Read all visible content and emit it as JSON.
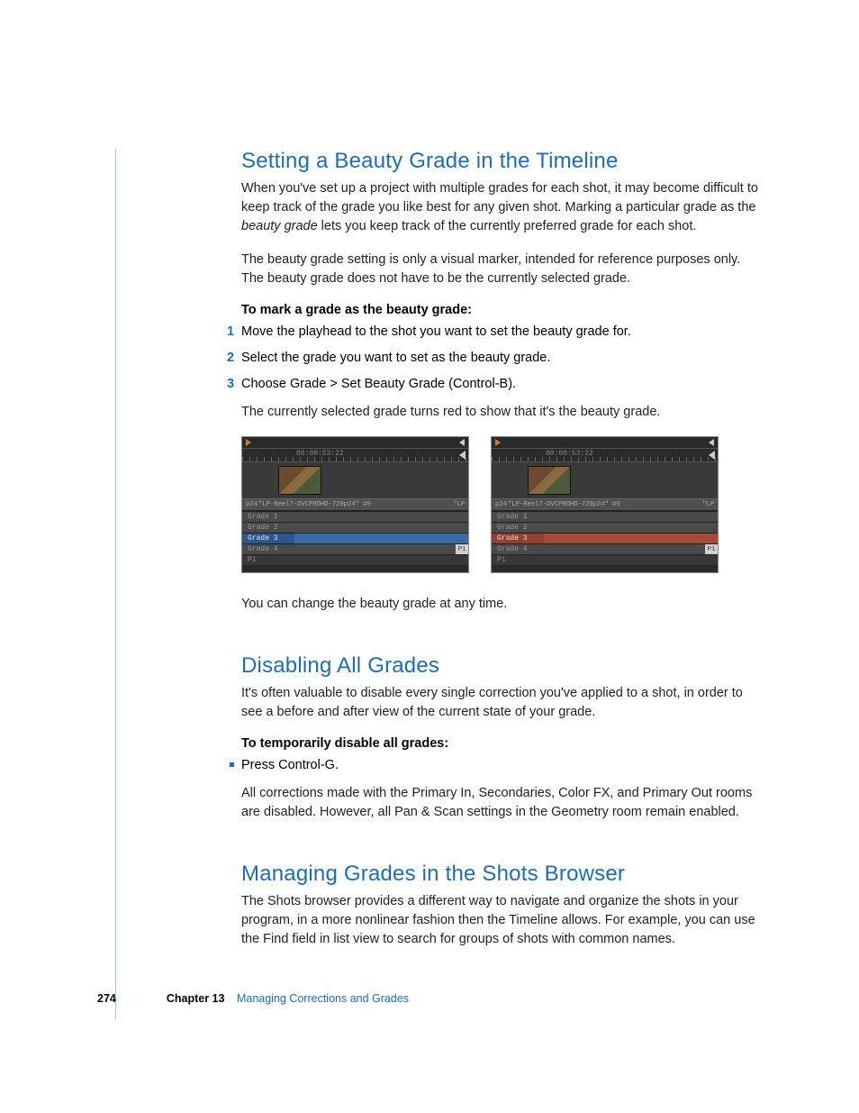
{
  "section1": {
    "heading": "Setting a Beauty Grade in the Timeline",
    "para1a": "When you've set up a project with multiple grades for each shot, it may become difficult to keep track of the grade you like best for any given shot. Marking a particular grade as the ",
    "para1_em": "beauty grade",
    "para1b": " lets you keep track of the currently preferred grade for each shot.",
    "para2": "The beauty grade setting is only a visual marker, intended for reference purposes only. The beauty grade does not have to be the currently selected grade.",
    "intro": "To mark a grade as the beauty grade:",
    "step1": "Move the playhead to the shot you want to set the beauty grade for.",
    "step2": "Select the grade you want to set as the beauty grade.",
    "step3": "Choose Grade > Set Beauty Grade (Control-B).",
    "after_steps": "The currently selected grade turns red to show that it's the beauty grade.",
    "after_images": "You can change the beauty grade at any time."
  },
  "shots": {
    "timecode": "00:00:53:22",
    "clip_label_a": "\"LP-Reel7-DVCPROHD-720p24\" #9",
    "clip_label_b": "\"LP",
    "grades": {
      "g1": "Grade 1",
      "g2": "Grade 2",
      "g3": "Grade 3",
      "g4": "Grade 4",
      "p1": "P1"
    },
    "tag": "P1"
  },
  "section2": {
    "heading": "Disabling All Grades",
    "para1": "It's often valuable to disable every single correction you've applied to a shot, in order to see a before and after view of the current state of your grade.",
    "intro": "To temporarily disable all grades:",
    "bullet1": "Press Control-G.",
    "after": "All corrections made with the Primary In, Secondaries, Color FX, and Primary Out rooms are disabled. However, all Pan & Scan settings in the Geometry room remain enabled."
  },
  "section3": {
    "heading": "Managing Grades in the Shots Browser",
    "para1": "The Shots browser provides a different way to navigate and organize the shots in your program, in a more nonlinear fashion then the Timeline allows. For example, you can use the Find field in list view to search for groups of shots with common names."
  },
  "footer": {
    "page": "274",
    "chapter_label": "Chapter 13",
    "chapter_title": "Managing Corrections and Grades"
  }
}
